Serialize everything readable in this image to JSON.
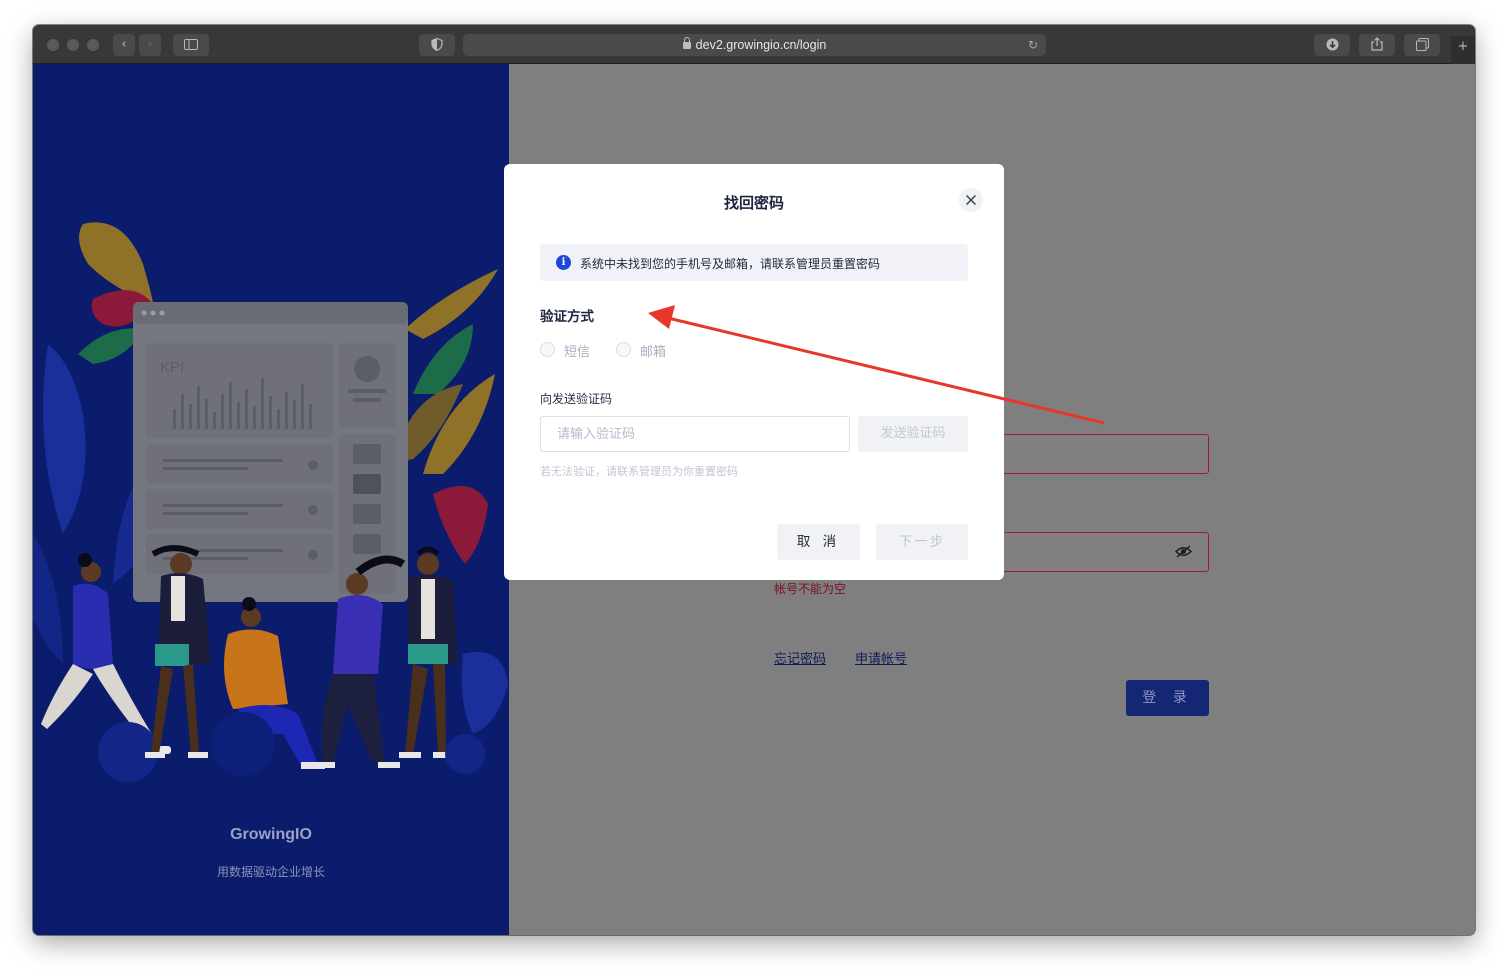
{
  "browser": {
    "url": "dev2.growingio.cn/login"
  },
  "brand": {
    "name": "GrowingIO",
    "slogan": "用数据驱动企业增长",
    "kpi_label": "KPI"
  },
  "login_form": {
    "error_text": "帐号不能为空",
    "forgot_password_link": "忘记密码",
    "apply_account_link": "申请帐号",
    "login_button": "登 录"
  },
  "modal": {
    "title": "找回密码",
    "alert_text": "系统中未找到您的手机号及邮箱，请联系管理员重置密码",
    "verify_method_label": "验证方式",
    "radio_options": [
      "短信",
      "邮箱"
    ],
    "send_to_label": "向发送验证码",
    "code_placeholder": "请输入验证码",
    "send_code_button": "发送验证码",
    "hint_text": "若无法验证，请联系管理员为你重置密码",
    "cancel_button": "取 消",
    "next_button": "下一步"
  },
  "colors": {
    "left_panel": "#0b1c6c",
    "info_icon": "#1d48d9",
    "error_border": "#a3183b",
    "annotation_arrow": "#e8372a"
  }
}
